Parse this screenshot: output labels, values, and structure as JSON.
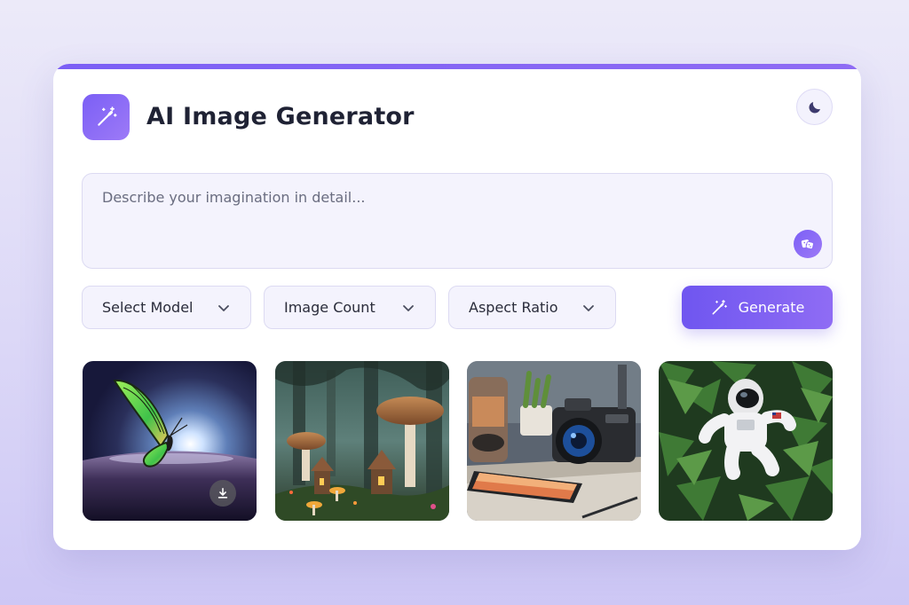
{
  "app": {
    "title": "AI Image Generator",
    "logo_icon": "magic-wand-icon",
    "theme_toggle_icon": "moon-icon"
  },
  "colors": {
    "accent_start": "#7b5ff5",
    "accent_end": "#8f6cf4",
    "title": "#1f2234",
    "input_bg": "#f4f3fd",
    "input_border": "#dcdaf2"
  },
  "prompt": {
    "placeholder": "Describe your imagination in detail...",
    "value": "",
    "random_icon": "dice-icon"
  },
  "controls": {
    "model_select": {
      "label": "Select Model"
    },
    "count_select": {
      "label": "Image Count"
    },
    "ratio_select": {
      "label": "Aspect Ratio"
    },
    "generate_button": {
      "label": "Generate",
      "icon": "magic-wand-icon"
    }
  },
  "gallery": {
    "images": [
      {
        "subject": "butterfly",
        "has_download": true,
        "download_icon": "download-icon"
      },
      {
        "subject": "mushroom-forest",
        "has_download": false
      },
      {
        "subject": "camera-desk",
        "has_download": false
      },
      {
        "subject": "astronaut-jungle",
        "has_download": false
      }
    ]
  }
}
